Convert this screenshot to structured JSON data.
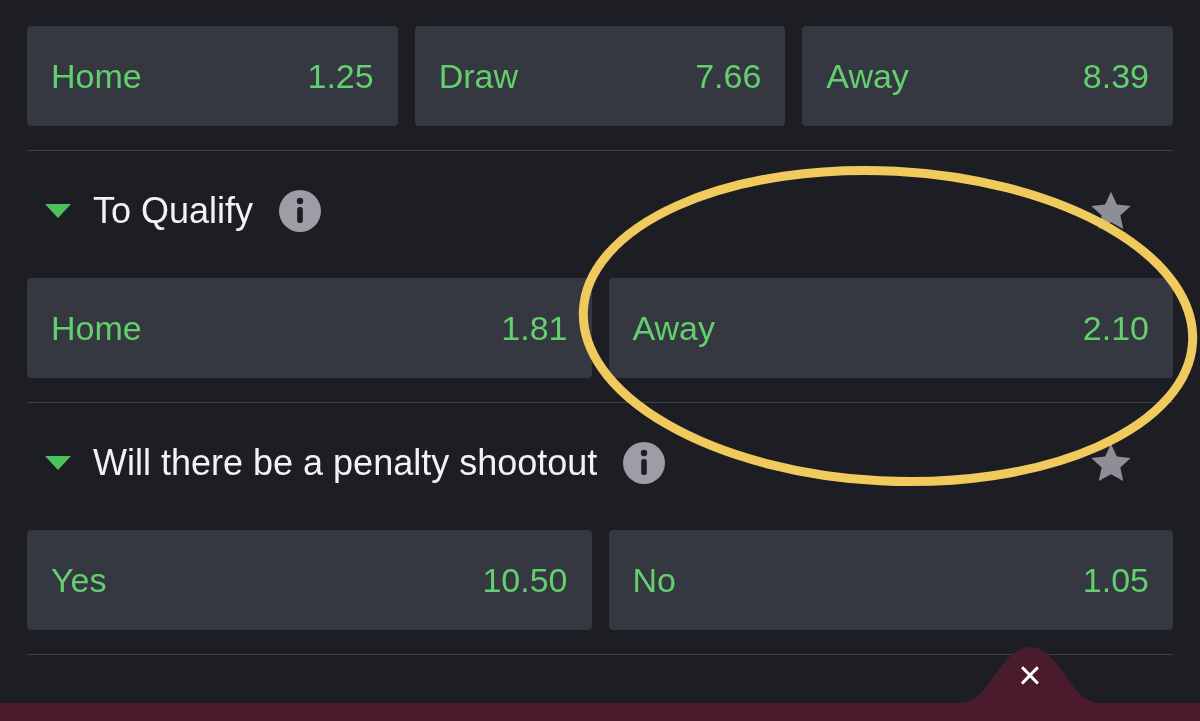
{
  "markets": [
    {
      "selections": [
        {
          "label": "Home",
          "odds": "1.25"
        },
        {
          "label": "Draw",
          "odds": "7.66"
        },
        {
          "label": "Away",
          "odds": "8.39"
        }
      ]
    },
    {
      "title": "To Qualify",
      "expanded": true,
      "selections": [
        {
          "label": "Home",
          "odds": "1.81"
        },
        {
          "label": "Away",
          "odds": "2.10"
        }
      ]
    },
    {
      "title": "Will there be a penalty shootout",
      "expanded": true,
      "selections": [
        {
          "label": "Yes",
          "odds": "10.50"
        },
        {
          "label": "No",
          "odds": "1.05"
        }
      ]
    }
  ],
  "close_tab": {
    "symbol": "×"
  }
}
